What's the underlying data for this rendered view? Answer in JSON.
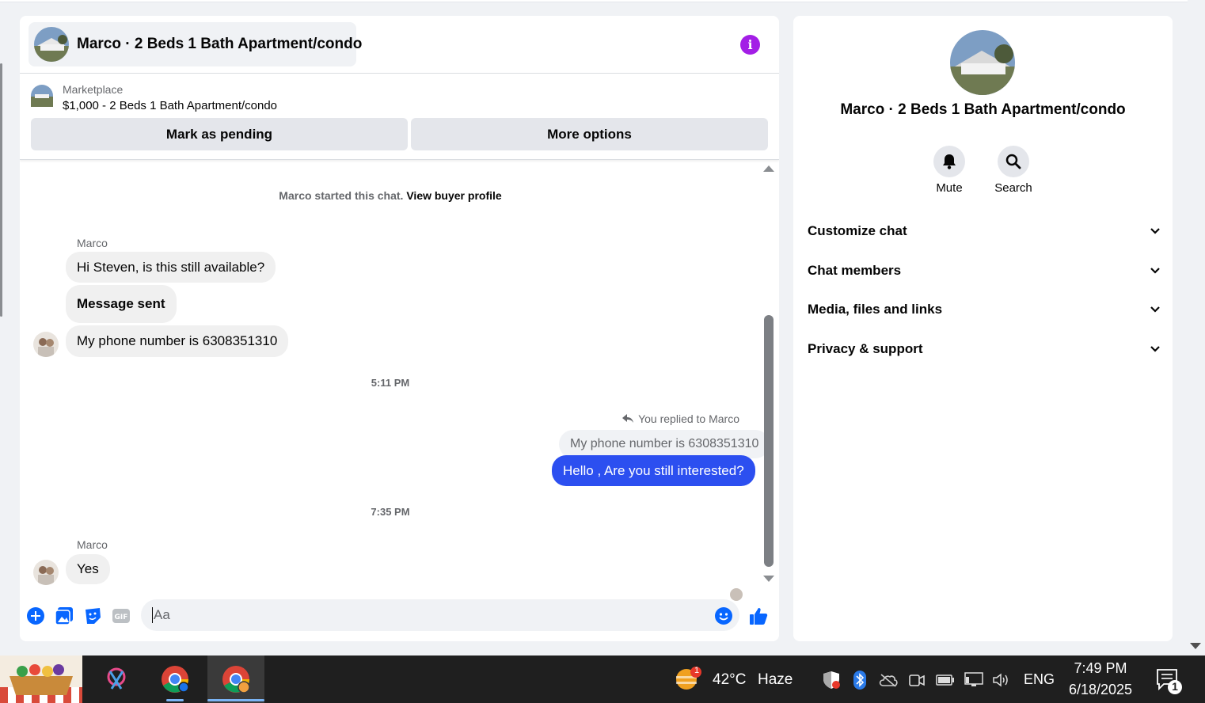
{
  "chat": {
    "title": "Marco · 2 Beds 1 Bath Apartment/condo",
    "info_icon": "info-icon",
    "listing": {
      "label": "Marketplace",
      "price_title": "$1,000 - 2 Beds 1 Bath Apartment/condo",
      "mark_pending": "Mark as pending",
      "more_options": "More options"
    },
    "system_text": "Marco started this chat.",
    "system_link": "View buyer profile",
    "messages": {
      "m1_sender": "Marco",
      "m1": "Hi Steven, is this still available?",
      "m2": "Message sent",
      "m3": "My phone number is 6308351310",
      "time1": "5:11 PM",
      "replied_label": "You replied to Marco",
      "quoted": "My phone number is 6308351310",
      "out1": "Hello , Are you still interested?",
      "time2": "7:35 PM",
      "m4_sender": "Marco",
      "m4": "Yes"
    },
    "composer": {
      "placeholder": "Aa"
    },
    "colors": {
      "accent": "#2c4ff0",
      "info": "#a31ee6",
      "composer_icons": "#0866ff"
    }
  },
  "side": {
    "title": "Marco · 2 Beds 1 Bath Apartment/condo",
    "mute": "Mute",
    "search": "Search",
    "sections": [
      "Customize chat",
      "Chat members",
      "Media, files and links",
      "Privacy & support"
    ]
  },
  "taskbar": {
    "weather_temp": "42°C",
    "weather_desc": "Haze",
    "weather_badge": "1",
    "language": "ENG",
    "time": "7:49 PM",
    "date": "6/18/2025",
    "notif_count": "1"
  }
}
